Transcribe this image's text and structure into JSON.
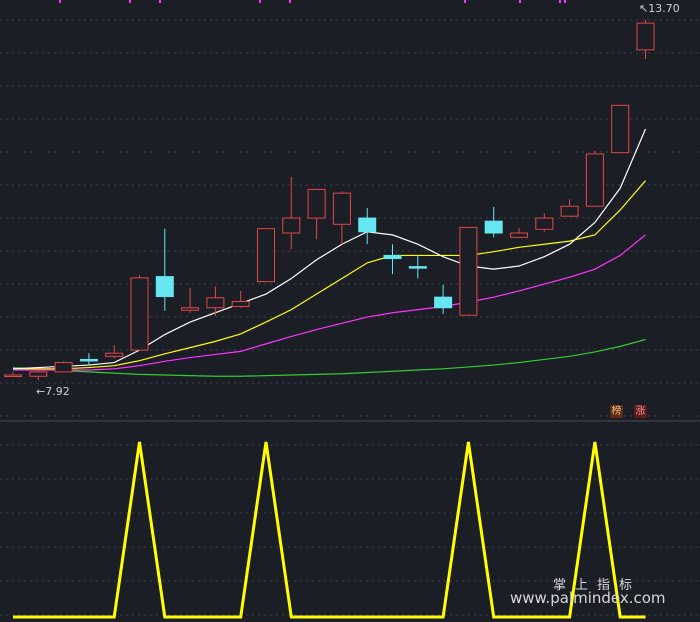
{
  "colors": {
    "background": "#1c1e25",
    "grid": "#3a3d47",
    "up": "#e0464a",
    "down": "#66e6f0",
    "ma_fast": "#ffffff",
    "ma_mid": "#ffff00",
    "ma_slow": "#ff33ff",
    "ma_long": "#33cc33",
    "indicator": "#ffff00"
  },
  "labels": {
    "low": "7.92",
    "high": "13.70",
    "tag_a": "榜",
    "tag_b": "涨",
    "watermark_cn": "掌上指标",
    "watermark_url": "www.palmindex.com"
  },
  "chart_data": [
    {
      "type": "candlestick",
      "ylim": [
        7.3,
        14.0
      ],
      "candles": [
        {
          "o": 8.0,
          "c": 8.0,
          "h": 8.05,
          "l": 7.97,
          "dir": "up"
        },
        {
          "o": 7.98,
          "c": 8.05,
          "h": 8.08,
          "l": 7.92,
          "dir": "up"
        },
        {
          "o": 8.05,
          "c": 8.2,
          "h": 8.22,
          "l": 8.05,
          "dir": "up"
        },
        {
          "o": 8.25,
          "c": 8.25,
          "h": 8.35,
          "l": 8.17,
          "dir": "down"
        },
        {
          "o": 8.3,
          "c": 8.35,
          "h": 8.48,
          "l": 8.27,
          "dir": "up"
        },
        {
          "o": 8.4,
          "c": 9.56,
          "h": 9.6,
          "l": 8.4,
          "dir": "up"
        },
        {
          "o": 9.58,
          "c": 9.26,
          "h": 10.35,
          "l": 9.03,
          "dir": "down"
        },
        {
          "o": 9.04,
          "c": 9.08,
          "h": 9.4,
          "l": 9.0,
          "dir": "up"
        },
        {
          "o": 9.08,
          "c": 9.24,
          "h": 9.42,
          "l": 8.95,
          "dir": "up"
        },
        {
          "o": 9.1,
          "c": 9.18,
          "h": 9.35,
          "l": 9.08,
          "dir": "up"
        },
        {
          "o": 9.5,
          "c": 10.35,
          "h": 10.35,
          "l": 9.5,
          "dir": "up"
        },
        {
          "o": 10.28,
          "c": 10.52,
          "h": 11.18,
          "l": 10.02,
          "dir": "up"
        },
        {
          "o": 10.52,
          "c": 10.98,
          "h": 10.98,
          "l": 10.18,
          "dir": "up"
        },
        {
          "o": 10.42,
          "c": 10.92,
          "h": 10.95,
          "l": 10.1,
          "dir": "up"
        },
        {
          "o": 10.52,
          "c": 10.3,
          "h": 10.68,
          "l": 10.1,
          "dir": "down"
        },
        {
          "o": 9.92,
          "c": 9.87,
          "h": 10.1,
          "l": 9.62,
          "dir": "down"
        },
        {
          "o": 9.74,
          "c": 9.72,
          "h": 9.92,
          "l": 9.55,
          "dir": "down"
        },
        {
          "o": 9.25,
          "c": 9.08,
          "h": 9.45,
          "l": 8.98,
          "dir": "down"
        },
        {
          "o": 8.96,
          "c": 10.37,
          "h": 10.37,
          "l": 8.96,
          "dir": "up"
        },
        {
          "o": 10.47,
          "c": 10.28,
          "h": 10.7,
          "l": 10.21,
          "dir": "down"
        },
        {
          "o": 10.21,
          "c": 10.28,
          "h": 10.36,
          "l": 10.21,
          "dir": "up"
        },
        {
          "o": 10.34,
          "c": 10.52,
          "h": 10.6,
          "l": 10.3,
          "dir": "up"
        },
        {
          "o": 10.55,
          "c": 10.71,
          "h": 10.82,
          "l": 10.55,
          "dir": "up"
        },
        {
          "o": 10.71,
          "c": 11.55,
          "h": 11.6,
          "l": 10.71,
          "dir": "up"
        },
        {
          "o": 11.57,
          "c": 12.33,
          "h": 12.33,
          "l": 11.57,
          "dir": "up"
        },
        {
          "o": 13.22,
          "c": 13.65,
          "h": 13.7,
          "l": 13.07,
          "dir": "up"
        }
      ],
      "ma_fast": [
        8.1,
        8.12,
        8.14,
        8.16,
        8.2,
        8.4,
        8.65,
        8.85,
        9.0,
        9.15,
        9.3,
        9.55,
        9.85,
        10.1,
        10.3,
        10.25,
        10.1,
        9.9,
        9.75,
        9.7,
        9.75,
        9.9,
        10.1,
        10.45,
        11.0,
        11.95
      ],
      "ma_mid": [
        8.1,
        8.1,
        8.1,
        8.12,
        8.15,
        8.23,
        8.34,
        8.44,
        8.54,
        8.66,
        8.85,
        9.05,
        9.3,
        9.55,
        9.8,
        9.92,
        9.92,
        9.92,
        9.92,
        9.98,
        10.05,
        10.1,
        10.15,
        10.25,
        10.65,
        11.12
      ],
      "ma_slow": [
        8.08,
        8.08,
        8.08,
        8.08,
        8.1,
        8.15,
        8.22,
        8.28,
        8.33,
        8.38,
        8.5,
        8.62,
        8.73,
        8.83,
        8.93,
        9.0,
        9.05,
        9.1,
        9.17,
        9.25,
        9.35,
        9.46,
        9.57,
        9.7,
        9.92,
        10.25
      ],
      "ma_long": [
        8.12,
        8.1,
        8.07,
        8.05,
        8.03,
        8.01,
        8.0,
        7.99,
        7.98,
        7.98,
        7.99,
        8.0,
        8.01,
        8.02,
        8.04,
        8.06,
        8.08,
        8.1,
        8.13,
        8.16,
        8.2,
        8.25,
        8.3,
        8.37,
        8.46,
        8.57
      ]
    },
    {
      "type": "line",
      "ylim": [
        0,
        1
      ],
      "series": [
        {
          "values": [
            0,
            0,
            0,
            0,
            0,
            1,
            0,
            0,
            0,
            0,
            1,
            0,
            0,
            0,
            0,
            0,
            0,
            0,
            1,
            0,
            0,
            0,
            0,
            1,
            0,
            0
          ]
        }
      ]
    }
  ]
}
